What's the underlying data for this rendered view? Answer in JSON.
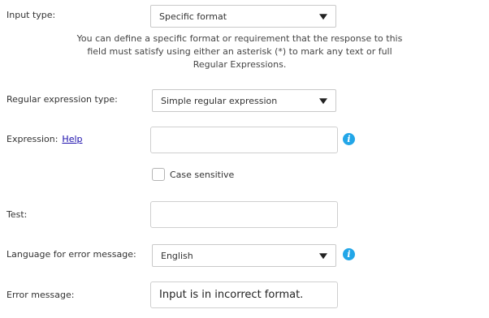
{
  "input_type": {
    "label": "Input type:",
    "selected": "Specific format",
    "help_text": "You can define a specific format or requirement that the response to this field must satisfy using either an asterisk (*) to mark any text or full Regular Expressions."
  },
  "regex_type": {
    "label": "Regular expression type:",
    "selected": "Simple regular expression"
  },
  "expression": {
    "label": "Expression:",
    "help_link": "Help",
    "value": "",
    "info_icon": "info-icon"
  },
  "case_sensitive": {
    "label": "Case sensitive",
    "checked": false
  },
  "test": {
    "label": "Test:",
    "value": ""
  },
  "language": {
    "label": "Language for error message:",
    "selected": "English",
    "info_icon": "info-icon"
  },
  "error_message": {
    "label": "Error message:",
    "value": "Input is in incorrect format."
  },
  "colors": {
    "info_icon": "#22a6e8",
    "link": "#1a0dab"
  }
}
